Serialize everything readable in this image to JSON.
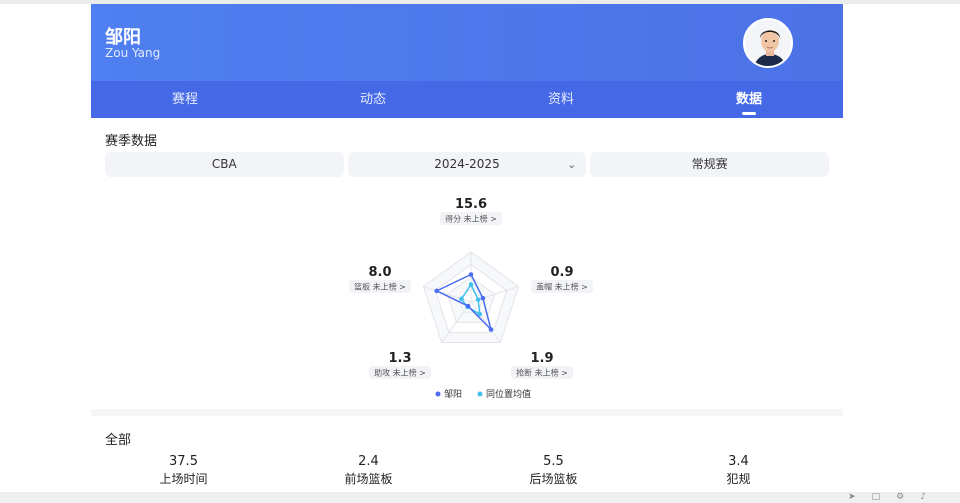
{
  "player": {
    "name_cn": "邹阳",
    "name_en": "Zou Yang"
  },
  "tabs": [
    {
      "label": "赛程",
      "active": false
    },
    {
      "label": "动态",
      "active": false
    },
    {
      "label": "资料",
      "active": false
    },
    {
      "label": "数据",
      "active": true
    }
  ],
  "season_section": {
    "title": "赛季数据",
    "filters": {
      "league": "CBA",
      "season": "2024-2025",
      "type": "常规赛"
    }
  },
  "radar": {
    "rank_text": "未上榜",
    "legend": {
      "player": "邹阳",
      "average": "同位置均值"
    },
    "colors": {
      "player": "#4a6cf0",
      "average": "#3fc1ee"
    },
    "axes": [
      {
        "label": "得分",
        "value": "15.6"
      },
      {
        "label": "盖帽",
        "value": "0.9"
      },
      {
        "label": "抢断",
        "value": "1.9"
      },
      {
        "label": "助攻",
        "value": "1.3"
      },
      {
        "label": "篮板",
        "value": "8.0"
      }
    ],
    "player_levels": [
      0.55,
      0.25,
      0.68,
      0.1,
      0.72
    ],
    "average_levels": [
      0.35,
      0.15,
      0.3,
      0.12,
      0.2
    ]
  },
  "all_section": {
    "title": "全部",
    "stats": [
      {
        "value": "37.5",
        "label": "上场时间"
      },
      {
        "value": "2.4",
        "label": "前场篮板"
      },
      {
        "value": "5.5",
        "label": "后场篮板"
      },
      {
        "value": "3.4",
        "label": "犯规"
      }
    ]
  }
}
